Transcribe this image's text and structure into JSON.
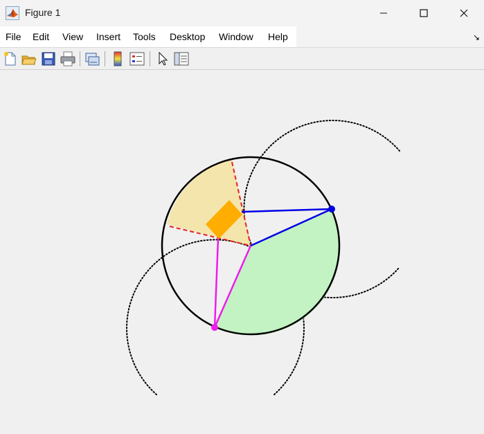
{
  "window": {
    "title": "Figure 1",
    "app_icon": "matlab-logo-icon",
    "controls": [
      "minimize-icon",
      "maximize-icon",
      "close-icon"
    ]
  },
  "menu": {
    "items": [
      "File",
      "Edit",
      "View",
      "Insert",
      "Tools",
      "Desktop",
      "Window",
      "Help"
    ],
    "dock_icon": "dock-arrow-icon"
  },
  "toolbar": {
    "tools": [
      "new-figure-icon",
      "open-file-icon",
      "save-icon",
      "print-icon",
      "link-plot-icon",
      "insert-colorbar-icon",
      "insert-legend-icon",
      "edit-plot-arrow-icon",
      "property-inspector-icon"
    ]
  },
  "figure": {
    "colors": {
      "main_circle": "#000000",
      "green_sector": "#c3f2c3",
      "tan_sector": "#f4e5ac",
      "orange_rect": "#ffad00",
      "blue": "#0000e6",
      "magenta": "#ee1cee",
      "red_dashed": "#e62020",
      "dotted_circles": "#000000"
    }
  }
}
